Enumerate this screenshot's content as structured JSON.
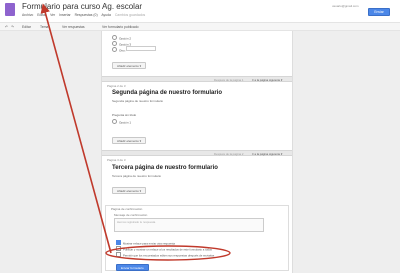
{
  "header": {
    "title": "Formulario para curso Ag. escolar",
    "star": "☆",
    "user_email": "usuario@gmail.com",
    "share_label": "Enviar formulario",
    "menu": [
      "Archivo",
      "Editar",
      "Ver",
      "Insertar",
      "Respuestas (0)",
      "Ayuda",
      "Cambios guardados"
    ]
  },
  "toolbar": {
    "items": [
      "Editar",
      "Tema",
      "Ver respuestas",
      "Ver formulario publicado"
    ]
  },
  "section1": {
    "options": [
      "Opción 2",
      "Opción 3",
      "Otro:"
    ],
    "add_button": "Añadir elemento ▾"
  },
  "pagebar1": {
    "after": "Después de la página 1",
    "goto": "Ir a la página siguiente ▾"
  },
  "section2": {
    "page_label": "Página 2 de 3",
    "title": "Segunda página de nuestro formulario",
    "description": "Segunda página de nuestro formulario",
    "question": "Pregunta sin título",
    "option": "Opción 1",
    "add_button": "Añadir elemento ▾"
  },
  "pagebar2": {
    "after": "Después de la página 2",
    "goto": "Ir a la página siguiente ▾"
  },
  "section3": {
    "page_label": "Página 3 de 3",
    "title": "Tercera página de nuestro formulario",
    "description": "Tercera página de nuestro formulario",
    "add_button": "Añadir elemento ▾"
  },
  "confirmation": {
    "page_label": "Página de confirmación",
    "message_label": "Mensaje de confirmación",
    "message_value": "Hemos registrado tu respuesta.",
    "options": [
      "Mostrar enlace para enviar otra respuesta",
      "Publicar y mostrar un enlace a los resultados de este formulario a todos",
      "Permitir que los encuestados editen sus respuestas después de enviarlas"
    ],
    "checked": [
      true,
      false,
      false
    ],
    "send_button": "Enviar formulario"
  },
  "accent_color": "#4b87e8",
  "annotation_color": "#c0392b"
}
